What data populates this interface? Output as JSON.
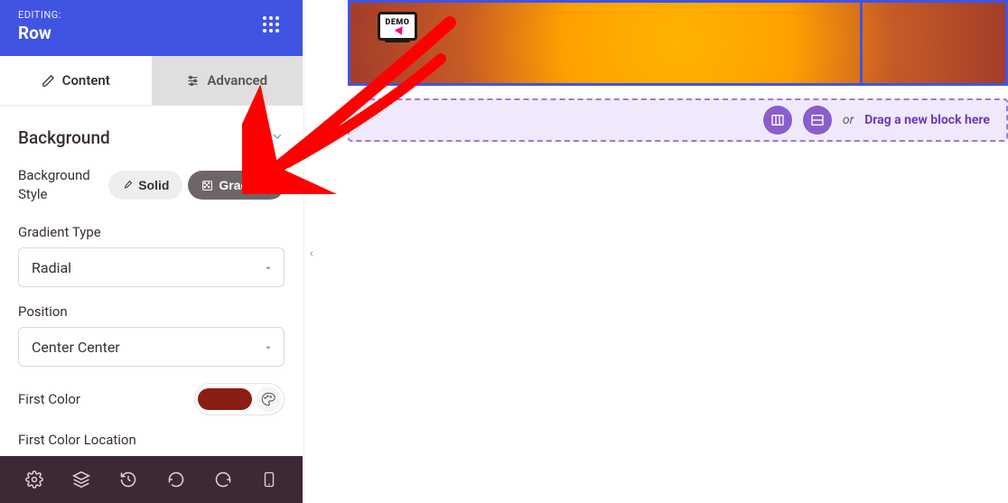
{
  "header": {
    "editing": "EDITING:",
    "title": "Row"
  },
  "tabs": {
    "content": "Content",
    "advanced": "Advanced"
  },
  "section": {
    "background_title": "Background"
  },
  "bg_style": {
    "label_line1": "Background",
    "label_line2": "Style",
    "solid": "Solid",
    "gradient": "Gradient"
  },
  "gradient_type": {
    "label": "Gradient Type",
    "value": "Radial"
  },
  "position": {
    "label": "Position",
    "value": "Center Center"
  },
  "first_color": {
    "label": "First Color",
    "hex": "#8c1d14"
  },
  "first_color_location": {
    "label": "First Color Location"
  },
  "drop": {
    "or": "or",
    "text": "Drag a new block here"
  },
  "demo": {
    "label": "DEMO"
  }
}
